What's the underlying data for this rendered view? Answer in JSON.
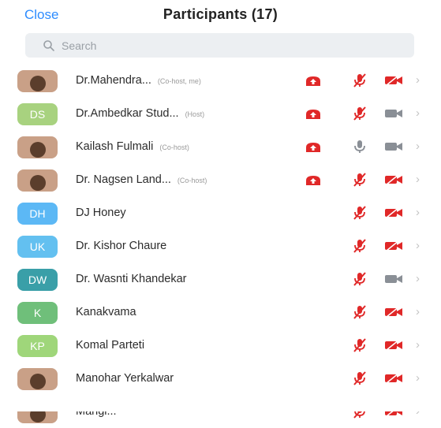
{
  "header": {
    "close_label": "Close",
    "title": "Participants (17)"
  },
  "search": {
    "placeholder": "Search",
    "icon": "search-icon"
  },
  "colors": {
    "accent": "#2D8CFF",
    "muted_red": "#E02828",
    "gray_icon": "#8a8f96"
  },
  "participants": [
    {
      "name": "Dr.Mahendra...",
      "role": "(Co-host, me)",
      "avatar": {
        "type": "photo",
        "initials": ""
      },
      "sharing": true,
      "mic": "muted",
      "video": "off"
    },
    {
      "name": "Dr.Ambedkar Stud...",
      "role": "(Host)",
      "avatar": {
        "type": "initials",
        "initials": "DS",
        "color": "#a8d27f"
      },
      "sharing": true,
      "mic": "muted",
      "video": "on"
    },
    {
      "name": "Kailash Fulmali",
      "role": "(Co-host)",
      "avatar": {
        "type": "photo",
        "initials": ""
      },
      "sharing": true,
      "mic": "unmuted",
      "video": "on"
    },
    {
      "name": "Dr. Nagsen Land...",
      "role": "(Co-host)",
      "avatar": {
        "type": "photo",
        "initials": ""
      },
      "sharing": true,
      "mic": "muted",
      "video": "off"
    },
    {
      "name": "DJ Honey",
      "role": "",
      "avatar": {
        "type": "initials",
        "initials": "DH",
        "color": "#5cb8f5"
      },
      "sharing": false,
      "mic": "muted",
      "video": "off"
    },
    {
      "name": "Dr. Kishor Chaure",
      "role": "",
      "avatar": {
        "type": "initials",
        "initials": "UK",
        "color": "#63c0f0"
      },
      "sharing": false,
      "mic": "muted",
      "video": "off"
    },
    {
      "name": "Dr. Wasnti Khandekar",
      "role": "",
      "avatar": {
        "type": "initials",
        "initials": "DW",
        "color": "#3a9fa8"
      },
      "sharing": false,
      "mic": "muted",
      "video": "on"
    },
    {
      "name": "Kanakvama",
      "role": "",
      "avatar": {
        "type": "initials",
        "initials": "K",
        "color": "#6fbf7a"
      },
      "sharing": false,
      "mic": "muted",
      "video": "off"
    },
    {
      "name": "Komal Parteti",
      "role": "",
      "avatar": {
        "type": "initials",
        "initials": "KP",
        "color": "#9fd67a"
      },
      "sharing": false,
      "mic": "muted",
      "video": "off"
    },
    {
      "name": "Manohar Yerkalwar",
      "role": "",
      "avatar": {
        "type": "photo",
        "initials": ""
      },
      "sharing": false,
      "mic": "muted",
      "video": "off"
    },
    {
      "name": "Mangi...",
      "role": "",
      "avatar": {
        "type": "photo",
        "initials": ""
      },
      "sharing": false,
      "mic": "muted",
      "video": "off"
    }
  ]
}
